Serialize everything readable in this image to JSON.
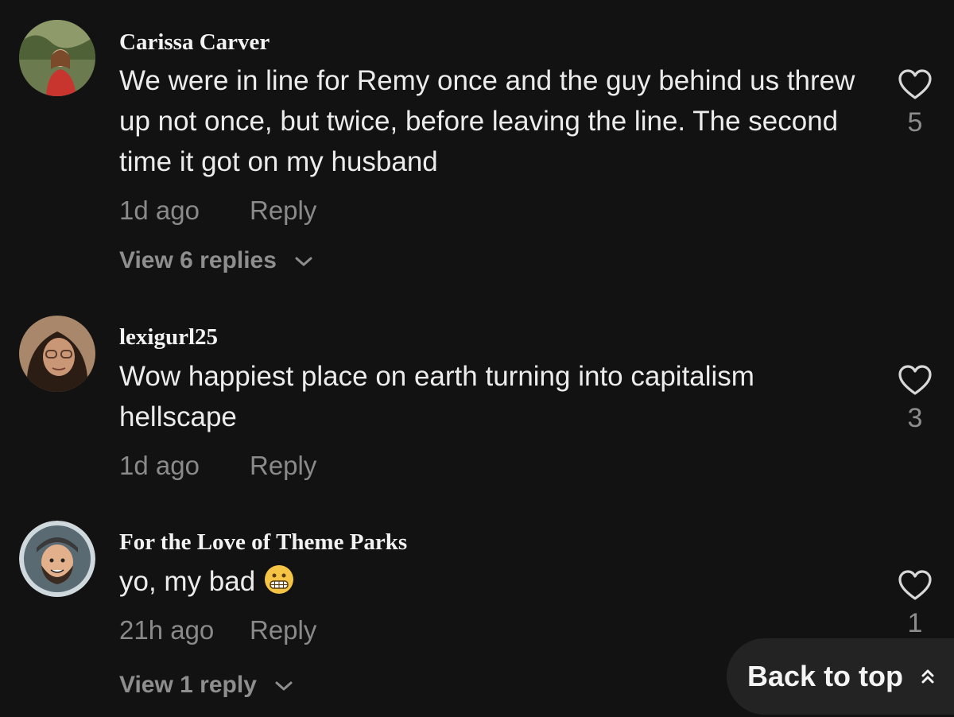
{
  "comments": [
    {
      "username": "Carissa Carver",
      "text": "We were in line for Remy once and the guy behind us threw up not once, but twice, before leaving the line. The second time it got on my husband",
      "time": "1d ago",
      "reply_label": "Reply",
      "likes": "5",
      "view_replies": "View 6 replies"
    },
    {
      "username": "lexigurl25",
      "text": "Wow happiest place on earth turning into capitalism hellscape",
      "time": "1d ago",
      "reply_label": "Reply",
      "likes": "3"
    },
    {
      "username": "For the Love of Theme Parks",
      "text": "yo, my bad",
      "emoji": "grimacing-face-emoji",
      "time": "21h ago",
      "reply_label": "Reply",
      "likes": "1",
      "view_replies": "View 1 reply"
    }
  ],
  "back_to_top": {
    "label": "Back to top",
    "icon": "double-chevron-up-icon"
  },
  "colors": {
    "background": "#121212",
    "secondary_text": "#8a8a8a",
    "pill": "#232323"
  }
}
